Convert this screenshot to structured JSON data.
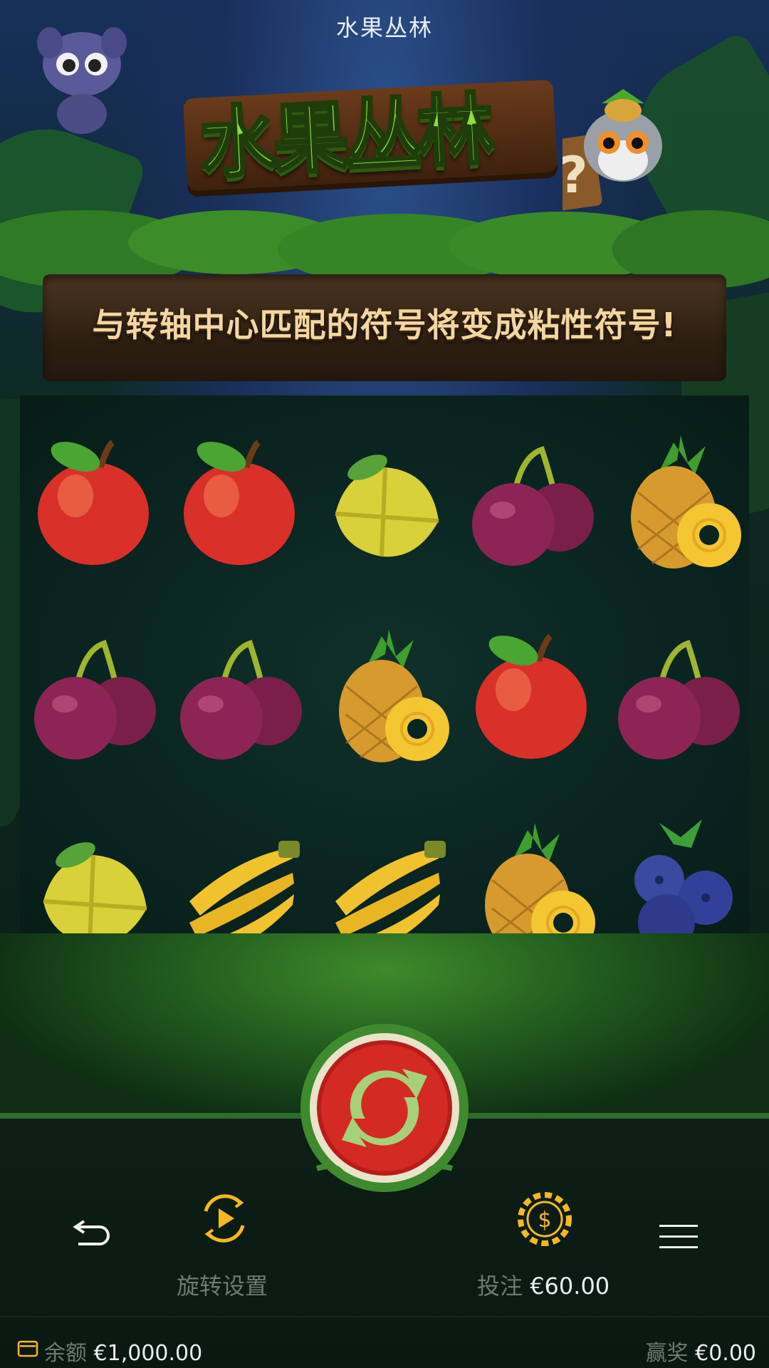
{
  "header": {
    "title": "水果丛林"
  },
  "logo": {
    "text": "水果丛林"
  },
  "banner": {
    "text": "与转轴中心匹配的符号将变成粘性符号!"
  },
  "reels": {
    "rows": [
      [
        "apple",
        "apple",
        "starfruit",
        "plum",
        "pineapple"
      ],
      [
        "plum",
        "plum",
        "pineapple",
        "apple",
        "plum"
      ],
      [
        "starfruit",
        "banana",
        "banana",
        "pineapple",
        "blueberry"
      ]
    ]
  },
  "controls": {
    "spin_settings_label": "旋转设置",
    "bet_label": "投注",
    "bet_value": "€60.00",
    "spin_icon": "spin-refresh-icon",
    "back_icon": "back-arrow-icon",
    "autoplay_icon": "play-circle-icon",
    "bet_icon": "dollar-chip-icon",
    "menu_icon": "menu-icon"
  },
  "footer": {
    "balance_label": "余额",
    "balance_value": "€1,000.00",
    "win_label": "赢奖",
    "win_value": "€0.00"
  },
  "colors": {
    "accent": "#f5b820",
    "spin_red": "#d42a24",
    "banner_text": "#f3d6a1",
    "label_gray": "#6e7a74"
  }
}
